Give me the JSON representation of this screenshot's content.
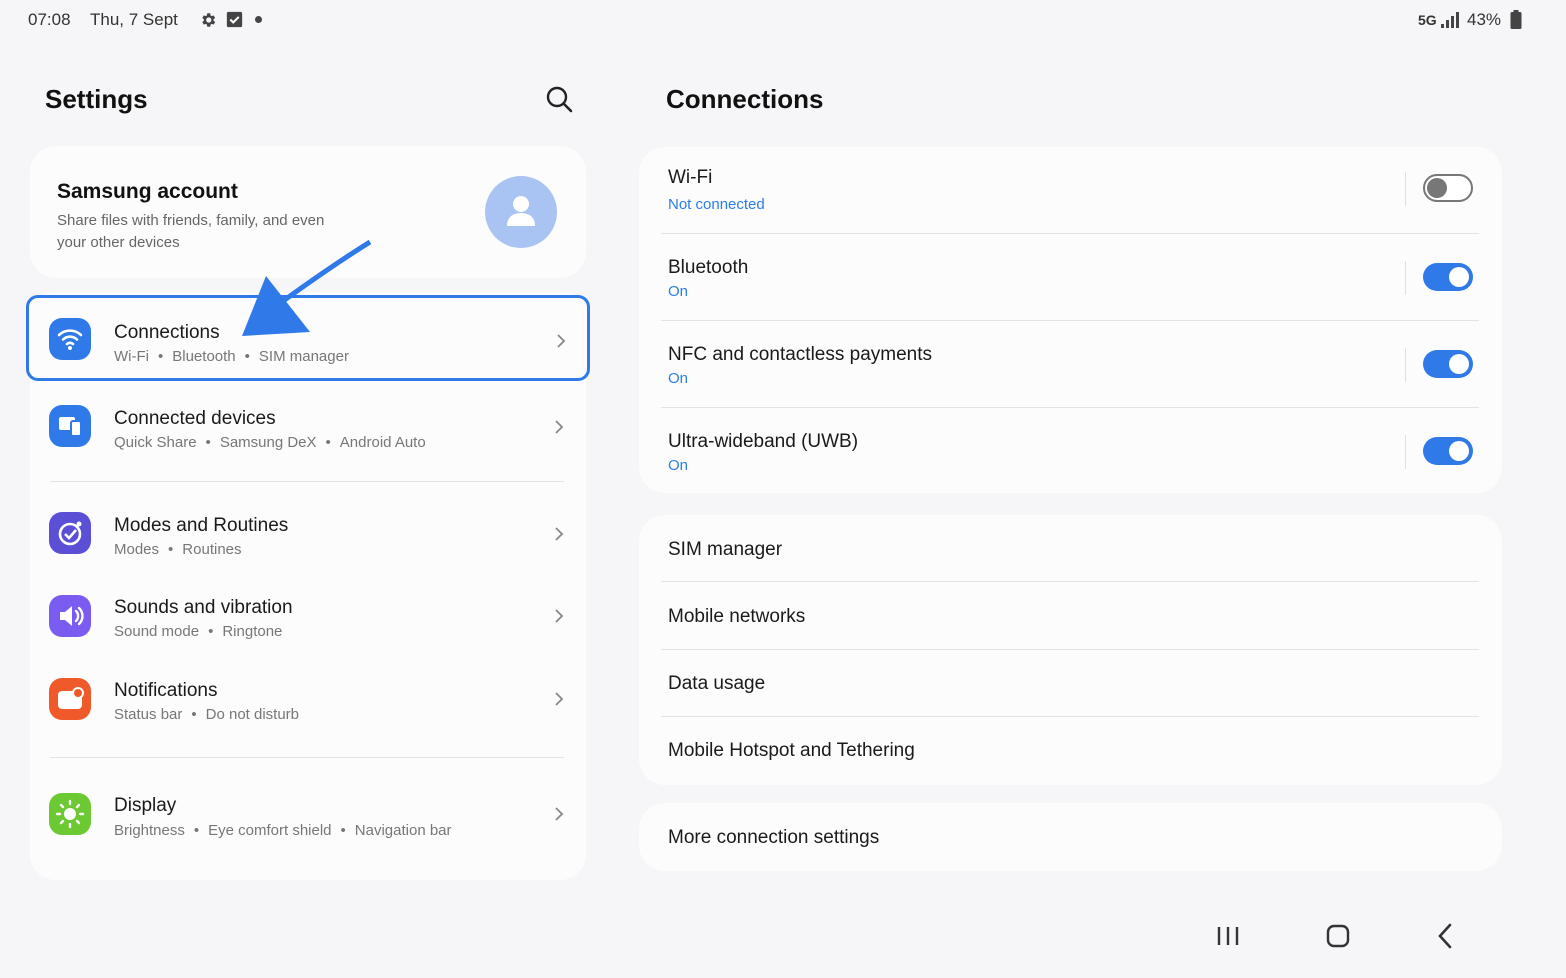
{
  "status_bar": {
    "time": "07:08",
    "date": "Thu, 7 Sept",
    "network": "5G",
    "battery": "43%"
  },
  "left_pane": {
    "title": "Settings",
    "account": {
      "title": "Samsung account",
      "description": "Share files with friends, family, and even your other devices"
    },
    "items": [
      {
        "title": "Connections",
        "sub": [
          "Wi-Fi",
          "Bluetooth",
          "SIM manager"
        ],
        "icon": "wifi-icon",
        "color": "#2f7ae8",
        "selected": true
      },
      {
        "title": "Connected devices",
        "sub": [
          "Quick Share",
          "Samsung DeX",
          "Android Auto"
        ],
        "icon": "devices-icon",
        "color": "#2f7ae8"
      },
      {
        "title": "Modes and Routines",
        "sub": [
          "Modes",
          "Routines"
        ],
        "icon": "check-circle-icon",
        "color": "#5b4fd6"
      },
      {
        "title": "Sounds and vibration",
        "sub": [
          "Sound mode",
          "Ringtone"
        ],
        "icon": "speaker-icon",
        "color": "#7a5cf0"
      },
      {
        "title": "Notifications",
        "sub": [
          "Status bar",
          "Do not disturb"
        ],
        "icon": "notification-icon",
        "color": "#f05a2a"
      },
      {
        "title": "Display",
        "sub": [
          "Brightness",
          "Eye comfort shield",
          "Navigation bar"
        ],
        "icon": "sun-icon",
        "color": "#6cc933"
      }
    ]
  },
  "right_pane": {
    "title": "Connections",
    "toggles": [
      {
        "title": "Wi-Fi",
        "status": "Not connected",
        "on": false
      },
      {
        "title": "Bluetooth",
        "status": "On",
        "on": true
      },
      {
        "title": "NFC and contactless payments",
        "status": "On",
        "on": true
      },
      {
        "title": "Ultra-wideband (UWB)",
        "status": "On",
        "on": true
      }
    ],
    "links": [
      "SIM manager",
      "Mobile networks",
      "Data usage",
      "Mobile Hotspot and Tethering"
    ],
    "more": "More connection settings"
  },
  "colors": {
    "accent": "#2f7ae8",
    "status_text": "#2b7de9"
  }
}
